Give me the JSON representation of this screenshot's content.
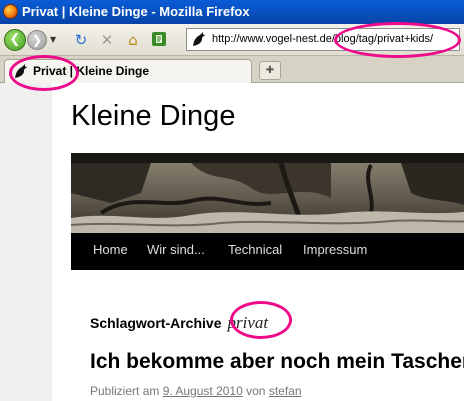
{
  "window": {
    "title": "Privat | Kleine Dinge - Mozilla Firefox"
  },
  "toolbar": {
    "back_icon": "back-arrow-icon",
    "forward_icon": "forward-arrow-icon",
    "url": "http://www.vogel-nest.de/blog/tag/privat+kids/"
  },
  "tab": {
    "title": "Privat | Kleine Dinge",
    "new_tab_icon": "new-tab-icon"
  },
  "page": {
    "site_title": "Kleine Dinge",
    "nav": [
      "Home",
      "Wir sind...",
      "Technical",
      "Impressum"
    ],
    "archive_label": "Schlagwort-Archive",
    "archive_tag": "privat",
    "post_title": "Ich bekomme aber noch mein Taschengeld",
    "meta_prefix": "Publiziert am",
    "meta_date": "9. August 2010",
    "meta_by": "von",
    "meta_author": "stefan"
  },
  "colors": {
    "highlight": "#ee0a8a",
    "titlebar": "#0a5cd6",
    "nav_bg": "#000000"
  }
}
